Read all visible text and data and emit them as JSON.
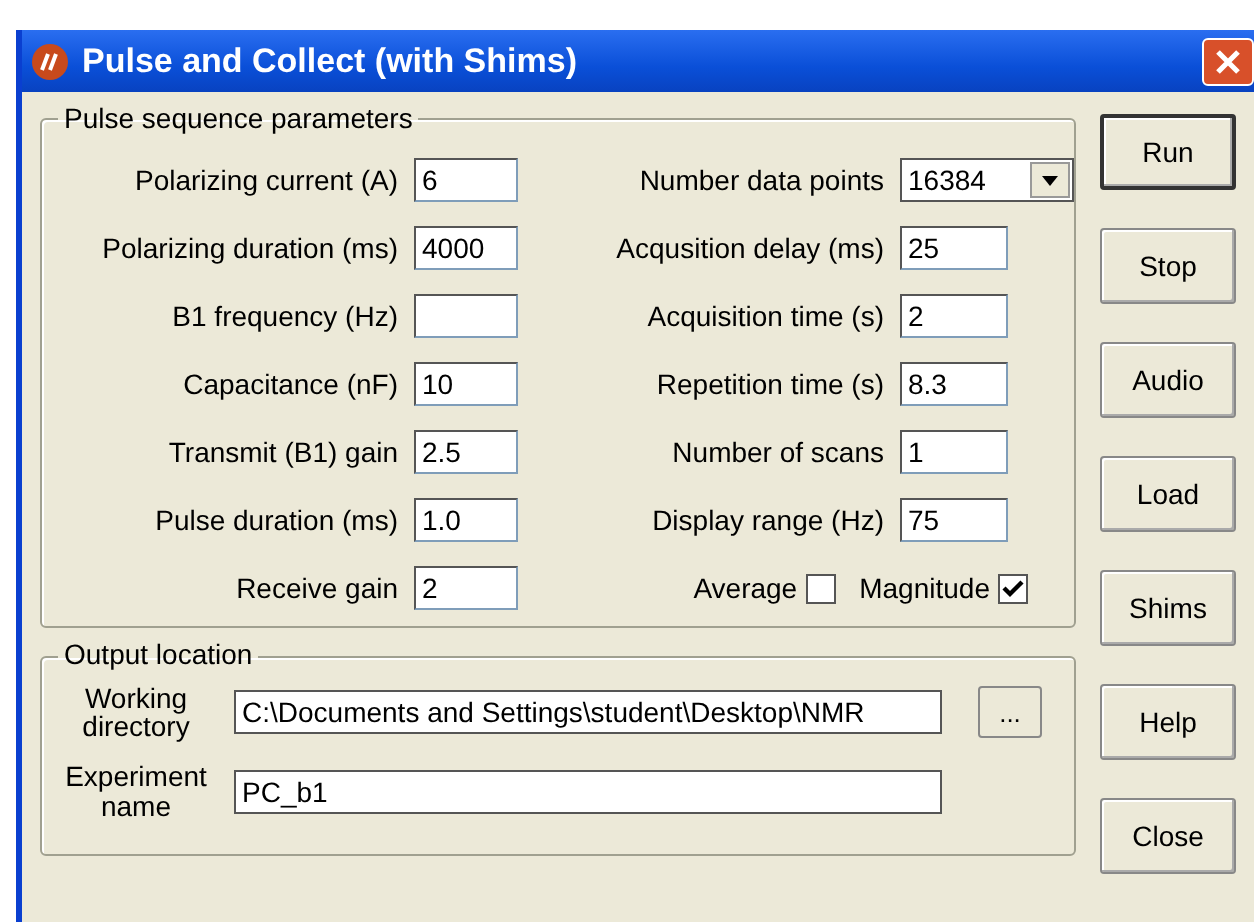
{
  "window": {
    "title": "Pulse and Collect (with Shims)"
  },
  "parameters": {
    "title": "Pulse sequence parameters",
    "left_fields": [
      {
        "label": "Polarizing current (A)",
        "value": "6"
      },
      {
        "label": "Polarizing duration (ms)",
        "value": "4000"
      },
      {
        "label": "B1 frequency (Hz)"
      },
      {
        "label": "Capacitance (nF)",
        "value": "10"
      },
      {
        "label": "Transmit (B1) gain",
        "value": "2.5"
      },
      {
        "label": "Pulse duration (ms)",
        "value": "1.0"
      },
      {
        "label": "Receive gain",
        "value": "2"
      }
    ],
    "right_fields": [
      {
        "kind": "dropdown",
        "label": "Number data points",
        "value": "16384"
      },
      {
        "kind": "text",
        "label": "Acqusition delay (ms)",
        "value": "25"
      },
      {
        "kind": "text",
        "label": "Acquisition time (s)",
        "value": "2"
      },
      {
        "kind": "text",
        "label": "Repetition time (s)",
        "value": "8.3"
      },
      {
        "kind": "text",
        "label": "Number of scans",
        "value": "1"
      },
      {
        "kind": "text",
        "label": "Display range (Hz)",
        "value": "75"
      }
    ],
    "checkboxes": [
      {
        "label": "Average",
        "checked": false
      },
      {
        "label": "Magnitude",
        "checked": true
      }
    ]
  },
  "output": {
    "title": "Output location",
    "fields": [
      {
        "label": "Working directory",
        "value": "C:\\Documents and Settings\\student\\Desktop\\NMR",
        "browse": "..."
      },
      {
        "label": "Experiment name",
        "value": "PC_b1"
      }
    ]
  },
  "buttons": [
    {
      "label": "Run",
      "default": true
    },
    {
      "label": "Stop",
      "default": false
    },
    {
      "label": "Audio",
      "default": false
    },
    {
      "label": "Load",
      "default": false
    },
    {
      "label": "Shims",
      "default": false
    },
    {
      "label": "Help",
      "default": false
    },
    {
      "label": "Close",
      "default": false
    }
  ]
}
